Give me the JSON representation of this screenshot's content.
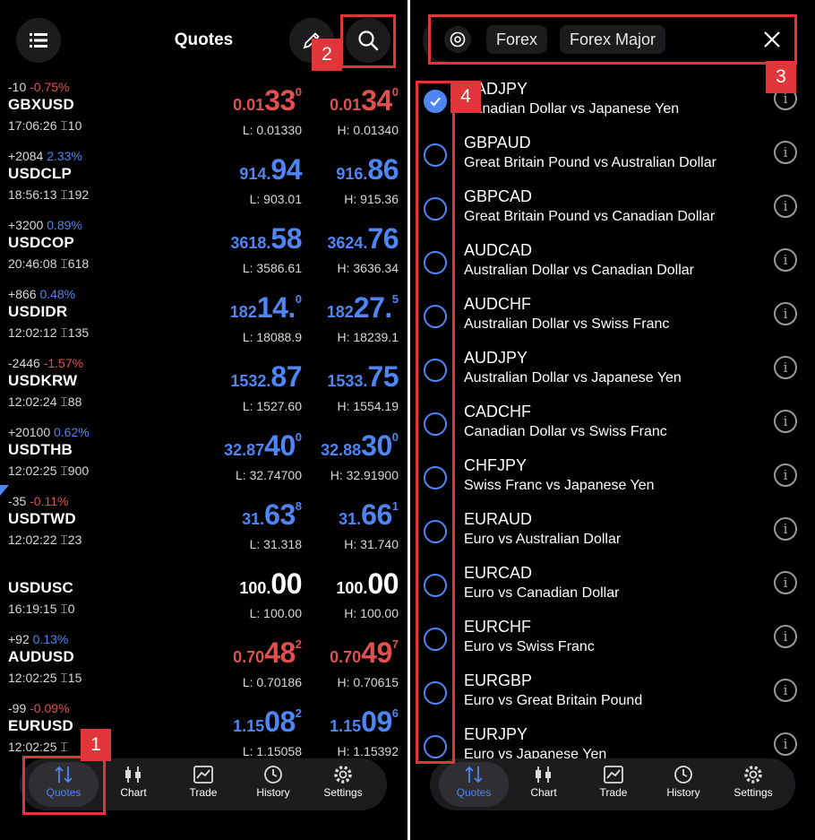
{
  "left": {
    "title": "Quotes",
    "quotes": [
      {
        "change": "-10",
        "pct": "-0.75%",
        "dir": "neg",
        "symbol": "GBXUSD",
        "time": "17:06:26 ⌶10",
        "bid": {
          "s": "0.01",
          "b": "33",
          "u": "0"
        },
        "ask": {
          "s": "0.01",
          "b": "34",
          "u": "0"
        },
        "color": "red",
        "low": "L: 0.01330",
        "high": "H: 0.01340"
      },
      {
        "change": "+2084",
        "pct": "2.33%",
        "dir": "pos",
        "symbol": "USDCLP",
        "time": "18:56:13 ⌶192",
        "bid": {
          "s": "914.",
          "b": "94",
          "u": ""
        },
        "ask": {
          "s": "916.",
          "b": "86",
          "u": ""
        },
        "color": "blue",
        "low": "L: 903.01",
        "high": "H: 915.36"
      },
      {
        "change": "+3200",
        "pct": "0.89%",
        "dir": "pos",
        "symbol": "USDCOP",
        "time": "20:46:08 ⌶618",
        "bid": {
          "s": "3618.",
          "b": "58",
          "u": ""
        },
        "ask": {
          "s": "3624.",
          "b": "76",
          "u": ""
        },
        "color": "blue",
        "low": "L: 3586.61",
        "high": "H: 3636.34"
      },
      {
        "change": "+866",
        "pct": "0.48%",
        "dir": "pos",
        "symbol": "USDIDR",
        "time": "12:02:12 ⌶135",
        "bid": {
          "s": "182",
          "b": "14.",
          "u": "0"
        },
        "ask": {
          "s": "182",
          "b": "27.",
          "u": "5"
        },
        "color": "blue",
        "low": "L: 18088.9",
        "high": "H: 18239.1"
      },
      {
        "change": "-2446",
        "pct": "-1.57%",
        "dir": "neg",
        "symbol": "USDKRW",
        "time": "12:02:24 ⌶88",
        "bid": {
          "s": "1532.",
          "b": "87",
          "u": ""
        },
        "ask": {
          "s": "1533.",
          "b": "75",
          "u": ""
        },
        "color": "blue",
        "low": "L: 1527.60",
        "high": "H: 1554.19"
      },
      {
        "change": "+20100",
        "pct": "0.62%",
        "dir": "pos",
        "symbol": "USDTHB",
        "time": "12:02:25 ⌶900",
        "bid": {
          "s": "32.87",
          "b": "40",
          "u": "0"
        },
        "ask": {
          "s": "32.88",
          "b": "30",
          "u": "0"
        },
        "color": "blue",
        "low": "L: 32.74700",
        "high": "H: 32.91900"
      },
      {
        "change": "-35",
        "pct": "-0.11%",
        "dir": "neg",
        "symbol": "USDTWD",
        "time": "12:02:22 ⌶23",
        "bid": {
          "s": "31.",
          "b": "63",
          "u": "8"
        },
        "ask": {
          "s": "31.",
          "b": "66",
          "u": "1"
        },
        "color": "blue",
        "low": "L: 31.318",
        "high": "H: 31.740"
      },
      {
        "change": "",
        "pct": "",
        "dir": "pos",
        "symbol": "USDUSC",
        "time": "16:19:15 ⌶0",
        "bid": {
          "s": "100.",
          "b": "00",
          "u": ""
        },
        "ask": {
          "s": "100.",
          "b": "00",
          "u": ""
        },
        "color": "white",
        "low": "L: 100.00",
        "high": "H: 100.00"
      },
      {
        "change": "+92",
        "pct": "0.13%",
        "dir": "pos",
        "symbol": "AUDUSD",
        "time": "12:02:25 ⌶15",
        "bid": {
          "s": "0.70",
          "b": "48",
          "u": "2"
        },
        "ask": {
          "s": "0.70",
          "b": "49",
          "u": "7"
        },
        "color": "red",
        "low": "L: 0.70186",
        "high": "H: 0.70615"
      },
      {
        "change": "-99",
        "pct": "-0.09%",
        "dir": "neg",
        "symbol": "EURUSD",
        "time": "12:02:25 ⌶",
        "bid": {
          "s": "1.15",
          "b": "08",
          "u": "2"
        },
        "ask": {
          "s": "1.15",
          "b": "09",
          "u": "6"
        },
        "color": "blue",
        "low": "L: 1.15058",
        "high": "H: 1.15392"
      }
    ],
    "nav": [
      {
        "label": "Quotes",
        "icon": "quotes-icon",
        "active": true
      },
      {
        "label": "Chart",
        "icon": "chart-icon",
        "active": false
      },
      {
        "label": "Trade",
        "icon": "trade-icon",
        "active": false
      },
      {
        "label": "History",
        "icon": "history-icon",
        "active": false
      },
      {
        "label": "Settings",
        "icon": "settings-icon",
        "active": false
      }
    ]
  },
  "right": {
    "chips": [
      "Forex",
      "Forex Major"
    ],
    "symbols": [
      {
        "symbol": "CADJPY",
        "desc": "Canadian Dollar vs Japanese Yen",
        "checked": true
      },
      {
        "symbol": "GBPAUD",
        "desc": "Great Britain Pound vs Australian Dollar",
        "checked": false
      },
      {
        "symbol": "GBPCAD",
        "desc": "Great Britain Pound vs Canadian Dollar",
        "checked": false
      },
      {
        "symbol": "AUDCAD",
        "desc": "Australian Dollar vs Canadian Dollar",
        "checked": false
      },
      {
        "symbol": "AUDCHF",
        "desc": "Australian Dollar vs Swiss Franc",
        "checked": false
      },
      {
        "symbol": "AUDJPY",
        "desc": "Australian Dollar vs Japanese Yen",
        "checked": false
      },
      {
        "symbol": "CADCHF",
        "desc": "Canadian Dollar vs Swiss Franc",
        "checked": false
      },
      {
        "symbol": "CHFJPY",
        "desc": "Swiss Franc vs Japanese Yen",
        "checked": false
      },
      {
        "symbol": "EURAUD",
        "desc": "Euro vs Australian Dollar",
        "checked": false
      },
      {
        "symbol": "EURCAD",
        "desc": "Euro vs Canadian Dollar",
        "checked": false
      },
      {
        "symbol": "EURCHF",
        "desc": "Euro vs Swiss Franc",
        "checked": false
      },
      {
        "symbol": "EURGBP",
        "desc": "Euro vs Great Britain Pound",
        "checked": false
      },
      {
        "symbol": "EURJPY",
        "desc": "Euro vs Japanese Yen",
        "checked": false
      }
    ],
    "nav": [
      {
        "label": "Quotes",
        "icon": "quotes-icon",
        "active": true
      },
      {
        "label": "Chart",
        "icon": "chart-icon",
        "active": false
      },
      {
        "label": "Trade",
        "icon": "trade-icon",
        "active": false
      },
      {
        "label": "History",
        "icon": "history-icon",
        "active": false
      },
      {
        "label": "Settings",
        "icon": "settings-icon",
        "active": false
      }
    ]
  },
  "annotations": [
    "1",
    "2",
    "3",
    "4"
  ],
  "colors": {
    "red": "#e0504f",
    "blue": "#4e86f5",
    "highlight": "#e0363a",
    "surface": "#1c1c1e"
  }
}
